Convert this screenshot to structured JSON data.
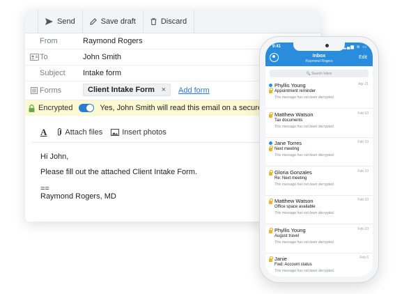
{
  "toolbar": {
    "send": "Send",
    "save_draft": "Save draft",
    "discard": "Discard"
  },
  "fields": {
    "from_label": "From",
    "from_value": "Raymond Rogers",
    "to_label": "To",
    "to_value": "John Smith",
    "subject_label": "Subject",
    "subject_value": "Intake form",
    "forms_label": "Forms",
    "form_chip": "Client Intake Form",
    "form_remove": "×",
    "add_form": "Add form"
  },
  "encryption": {
    "label": "Encrypted",
    "enabled": true,
    "message": "Yes, John Smith will read this email on a secure web pa"
  },
  "format_bar": {
    "text_format_glyph": "A",
    "attach": "Attach files",
    "insert": "Insert photos"
  },
  "body": {
    "greeting": "Hi John,",
    "line1": "Please fill out the attached Client Intake Form.",
    "sig_sep": "==",
    "signature": "Raymond Rogers, MD"
  },
  "phone": {
    "time": "9:41",
    "signal": "▂▄▆ ≋ ▭",
    "title": "Inbox",
    "subtitle": "Raymond Rogers",
    "edit": "Edit",
    "search_placeholder": "🔍 Search Inbox",
    "mails": [
      {
        "from": "Phyllis Young",
        "subject": "Appointment reminder",
        "preview": "This message has not been decrypted.",
        "date": "Apr 21",
        "unread": true
      },
      {
        "from": "Matthew Watson",
        "subject": "Tax documents",
        "preview": "This message has not been decrypted.",
        "date": "Feb 10",
        "unread": false
      },
      {
        "from": "Jane Torres",
        "subject": "Next meeting",
        "preview": "This message has not been decrypted.",
        "date": "Feb 10",
        "unread": true
      },
      {
        "from": "Gloria Gonzales",
        "subject": "Re: Next meeting",
        "preview": "This message has not been decrypted.",
        "date": "Feb 10",
        "unread": false
      },
      {
        "from": "Matthew Watson",
        "subject": "Office space available",
        "preview": "This message has not been decrypted.",
        "date": "Feb 10",
        "unread": false
      },
      {
        "from": "Phyllis Young",
        "subject": "August travel",
        "preview": "This message has not been decrypted.",
        "date": "Feb 10",
        "unread": false
      },
      {
        "from": "Janie",
        "subject": "Fwd: Account status",
        "preview": "This message has not been decrypted.",
        "date": "Feb 6",
        "unread": false
      }
    ]
  },
  "colors": {
    "accent": "#2a7ad6",
    "banner": "#fcf8d2",
    "lock": "#e8b52f",
    "phone_header": "#2a8cdd"
  }
}
